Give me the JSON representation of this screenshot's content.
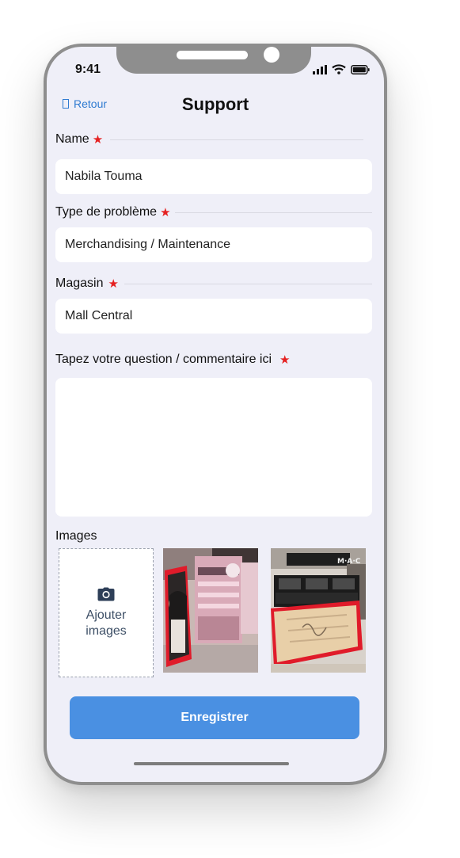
{
  "status_bar": {
    "time": "9:41"
  },
  "header": {
    "back_label": "Retour",
    "title": "Support"
  },
  "form": {
    "name": {
      "label": "Name",
      "value": "Nabila Touma"
    },
    "problem_type": {
      "label": "Type de problème",
      "value": "Merchandising / Maintenance"
    },
    "store": {
      "label": "Magasin",
      "value": "Mall Central"
    },
    "comment": {
      "label": "Tapez votre question / commentaire ici",
      "value": ""
    },
    "required_mark": "★"
  },
  "images": {
    "label": "Images",
    "add_label_line1": "Ajouter",
    "add_label_line2": "images",
    "photos": [
      "store-display-photo-1",
      "store-display-photo-2"
    ]
  },
  "submit_label": "Enregistrer",
  "colors": {
    "accent": "#4a90e2",
    "link": "#2f7bd1",
    "required": "#e52121",
    "background": "#efeff8"
  }
}
